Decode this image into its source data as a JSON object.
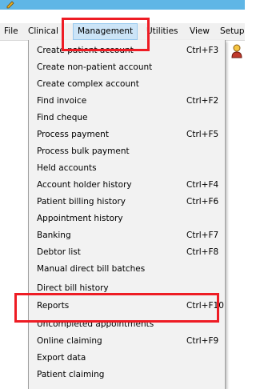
{
  "menubar": {
    "items": [
      {
        "label": "File"
      },
      {
        "label": "Clinical"
      },
      {
        "label": "Management"
      },
      {
        "label": "Utilities"
      },
      {
        "label": "View"
      },
      {
        "label": "Setup"
      }
    ]
  },
  "dropdown": {
    "items": [
      {
        "label": "Create patient account",
        "shortcut": "Ctrl+F3"
      },
      {
        "label": "Create non-patient account",
        "shortcut": ""
      },
      {
        "label": "Create complex account",
        "shortcut": ""
      },
      {
        "label": "Find invoice",
        "shortcut": "Ctrl+F2"
      },
      {
        "label": "Find cheque",
        "shortcut": ""
      },
      {
        "label": "Process payment",
        "shortcut": "Ctrl+F5"
      },
      {
        "label": "Process bulk payment",
        "shortcut": ""
      },
      {
        "label": "Held accounts",
        "shortcut": ""
      },
      {
        "label": "Account holder history",
        "shortcut": "Ctrl+F4"
      },
      {
        "label": "Patient billing history",
        "shortcut": "Ctrl+F6"
      },
      {
        "label": "Appointment history",
        "shortcut": ""
      },
      {
        "label": "Banking",
        "shortcut": "Ctrl+F7"
      },
      {
        "label": "Debtor list",
        "shortcut": "Ctrl+F8"
      },
      {
        "label": "Manual direct bill batches",
        "shortcut": ""
      },
      {
        "label": "Direct bill history",
        "shortcut": ""
      },
      {
        "label": "Reports",
        "shortcut": "Ctrl+F10"
      },
      {
        "label": "Uncompleted appointments",
        "shortcut": ""
      },
      {
        "label": "Online claiming",
        "shortcut": "Ctrl+F9"
      },
      {
        "label": "Export data",
        "shortcut": ""
      },
      {
        "label": "Patient claiming",
        "shortcut": ""
      }
    ]
  },
  "colors": {
    "titlebar": "#5fb6e6",
    "menu_open": "#cce4f7",
    "highlight": "#ee1c24"
  },
  "icons": {
    "app": "pencil-icon",
    "side": "person-icon"
  }
}
